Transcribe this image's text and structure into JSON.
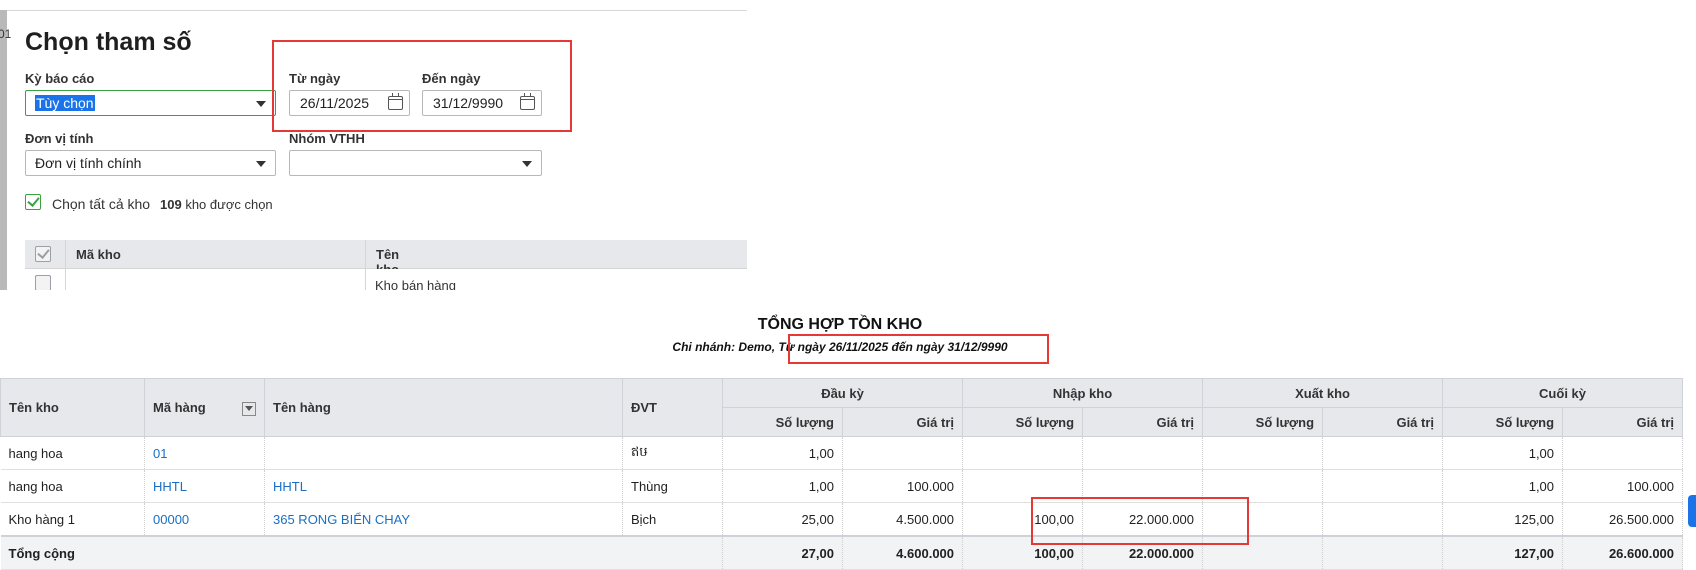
{
  "dialog": {
    "edge_text": "01",
    "title": "Chọn tham số",
    "report_period": {
      "label": "Kỳ báo cáo",
      "value": "Tùy chọn"
    },
    "from_date": {
      "label": "Từ ngày",
      "value": "26/11/2025"
    },
    "to_date": {
      "label": "Đến ngày",
      "value": "31/12/9990"
    },
    "unit": {
      "label": "Đơn vị tính",
      "value": "Đơn vị tính chính"
    },
    "group": {
      "label": "Nhóm VTHH",
      "value": ""
    },
    "select_all": {
      "label": "Chọn tất cả kho",
      "checked": true
    },
    "selected_count": {
      "count": "109",
      "text": "kho được chọn"
    },
    "warehouse_table": {
      "columns": [
        "Mã kho",
        "Tên kho"
      ],
      "partial_row": {
        "name": "Kho bán hàng"
      }
    }
  },
  "report": {
    "title": "TỔNG HỢP TỒN KHO",
    "subtitle": "Chi nhánh: Demo, Từ ngày 26/11/2025 đến ngày 31/12/9990",
    "columns": {
      "warehouse": "Tên kho",
      "item_code": "Mã hàng",
      "item_name": "Tên hàng",
      "unit": "ĐVT",
      "opening": "Đầu kỳ",
      "receipt": "Nhập kho",
      "issue": "Xuất kho",
      "closing": "Cuối kỳ",
      "qty": "Số lượng",
      "value": "Giá trị"
    },
    "rows": [
      {
        "warehouse": "hang hoa",
        "code": "01",
        "name": "",
        "unit": "ឥឞ",
        "open_qty": "1,00",
        "open_val": "",
        "in_qty": "",
        "in_val": "",
        "out_qty": "",
        "out_val": "",
        "close_qty": "1,00",
        "close_val": ""
      },
      {
        "warehouse": "hang hoa",
        "code": "HHTL",
        "name": "HHTL",
        "unit": "Thùng",
        "open_qty": "1,00",
        "open_val": "100.000",
        "in_qty": "",
        "in_val": "",
        "out_qty": "",
        "out_val": "",
        "close_qty": "1,00",
        "close_val": "100.000"
      },
      {
        "warehouse": "Kho hàng 1",
        "code": "00000",
        "name": "365 RONG BIỂN CHAY",
        "unit": "Bịch",
        "open_qty": "25,00",
        "open_val": "4.500.000",
        "in_qty": "100,00",
        "in_val": "22.000.000",
        "out_qty": "",
        "out_val": "",
        "close_qty": "125,00",
        "close_val": "26.500.000"
      }
    ],
    "total": {
      "label": "Tổng cộng",
      "open_qty": "27,00",
      "open_val": "4.600.000",
      "in_qty": "100,00",
      "in_val": "22.000.000",
      "out_qty": "",
      "out_val": "",
      "close_qty": "127,00",
      "close_val": "26.600.000"
    }
  },
  "colors": {
    "accent": "#1a73e8",
    "check_green": "#3aa240",
    "highlight_red": "#e53935",
    "header_bg": "#e6e8ec",
    "link_blue": "#1a6fc4"
  }
}
